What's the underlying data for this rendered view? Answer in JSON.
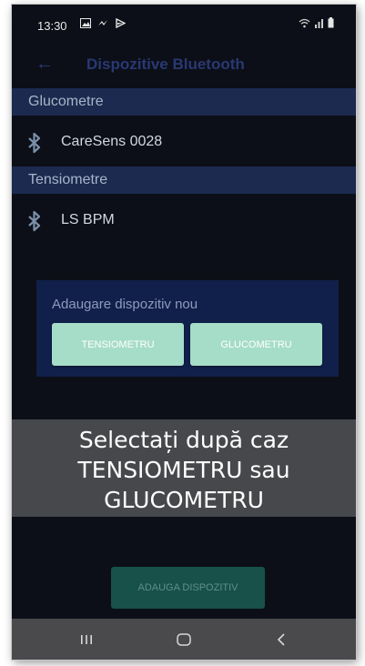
{
  "status_bar": {
    "time": "13:30",
    "left_icons": [
      "image-icon",
      "messenger-icon",
      "play-icon"
    ],
    "right_icons": [
      "wifi-icon",
      "signal-icon",
      "battery-icon"
    ]
  },
  "app_bar": {
    "title": "Dispozitive Bluetooth",
    "back_icon": "arrow-left-icon"
  },
  "sections": [
    {
      "header": "Glucometre",
      "devices": [
        {
          "name": "CareSens 0028",
          "icon": "bluetooth-icon"
        }
      ]
    },
    {
      "header": "Tensiometre",
      "devices": [
        {
          "name": "LS BPM",
          "icon": "bluetooth-icon"
        }
      ]
    }
  ],
  "dialog": {
    "title": "Adaugare dispozitiv nou",
    "buttons": [
      {
        "label": "TENSIOMETRU"
      },
      {
        "label": "GLUCOMETRU"
      }
    ]
  },
  "overlay": {
    "lines": [
      "Selectați după caz",
      "TENSIOMETRU sau",
      "GLUCOMETRU"
    ]
  },
  "bottom_button": {
    "label": "ADAUGA DISPOZITIV"
  },
  "nav_bar": {
    "icons": [
      "recent-apps-icon",
      "home-icon",
      "back-icon"
    ]
  },
  "colors": {
    "background": "#0c0f17",
    "section_header": "#1c2a4f",
    "dialog": "#10204a",
    "dialog_button": "#a6ddc8",
    "bottom_button": "#17514a",
    "nav_bar": "#4a4a4d"
  }
}
